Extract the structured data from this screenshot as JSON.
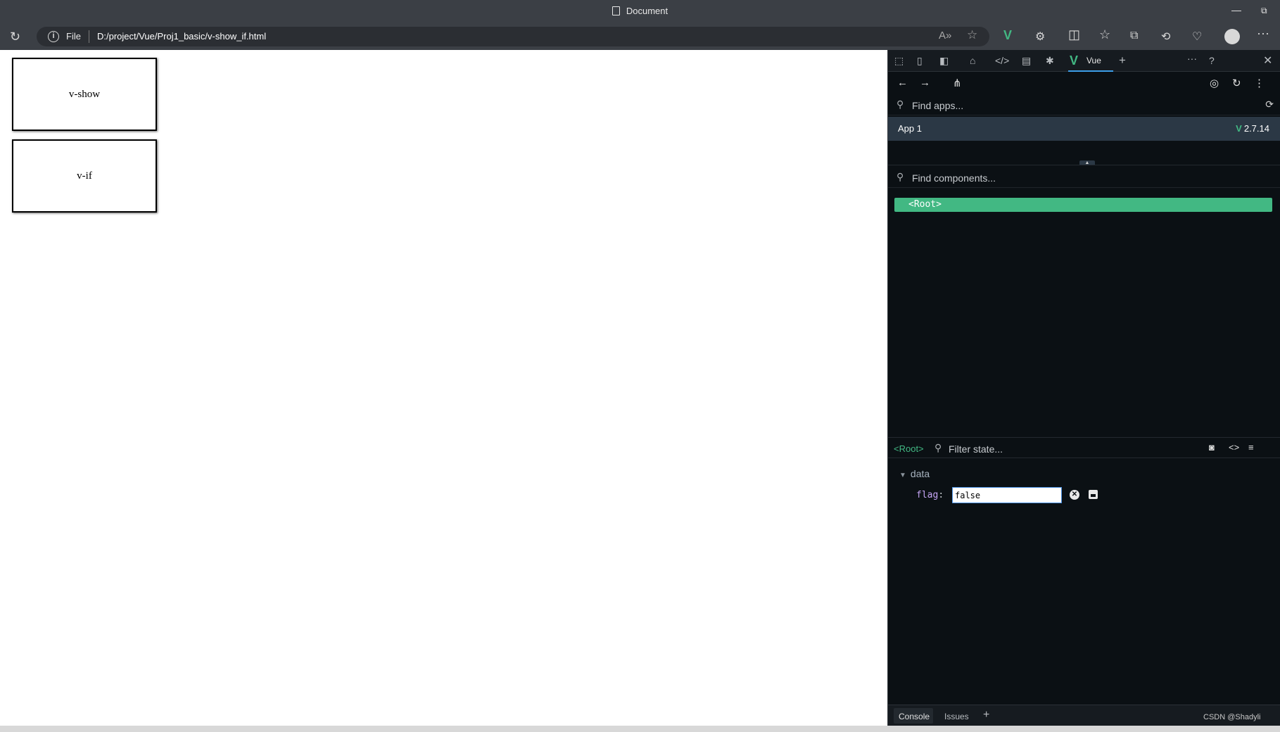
{
  "window": {
    "title": "Document",
    "minimize": "—",
    "restore": "⧉"
  },
  "address": {
    "info_icon": "i",
    "scheme_label": "File",
    "url": "D:/project/Vue/Proj1_basic/v-show_if.html"
  },
  "toolbar_icons": [
    "read-aloud-icon",
    "favorite-icon",
    "vue-devtools-icon",
    "extensions-icon",
    "split-screen-icon",
    "favorites-icon",
    "collections-icon",
    "history-icon",
    "performance-icon",
    "profile-icon",
    "more-icon"
  ],
  "page": {
    "boxes": [
      {
        "label": "v-show"
      },
      {
        "label": "v-if"
      }
    ]
  },
  "devtools": {
    "vue_tab_label": "Vue",
    "find_apps_placeholder": "Find apps...",
    "app": {
      "name": "App 1",
      "version": "2.7.14"
    },
    "find_components_placeholder": "Find components...",
    "root_component": "<Root>",
    "state": {
      "selected": "<Root>",
      "filter_placeholder": "Filter state...",
      "section": "data",
      "fields": [
        {
          "key": "flag",
          "value": "false"
        }
      ]
    },
    "drawer_tabs": [
      "Console",
      "Issues"
    ]
  },
  "watermark": "CSDN @Shadyli"
}
